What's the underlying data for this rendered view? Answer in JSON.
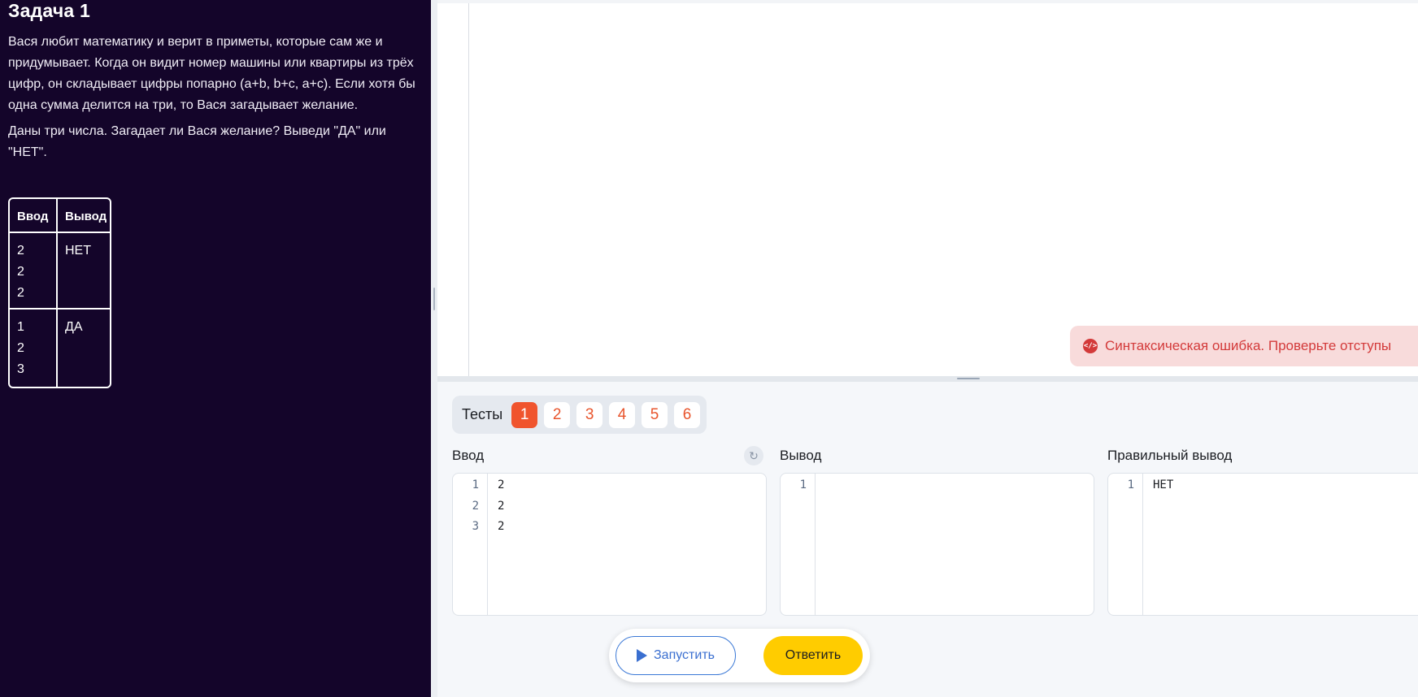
{
  "task": {
    "title": "Задача 1",
    "paragraph1": "Вася любит математику и верит в приметы, которые сам же и придумывает. Когда он видит номер машины или квартиры из трёх цифр, он складывает цифры попарно (a+b, b+c, a+c). Если хотя бы одна сумма делится на три, то Вася загадывает желание.",
    "paragraph2": "Даны три числа. Загадает ли Вася желание? Выведи \"ДА\" или \"НЕТ\".",
    "table": {
      "header_input": "Ввод",
      "header_output": "Вывод",
      "rows": [
        {
          "input": [
            "2",
            "2",
            "2"
          ],
          "output": "НЕТ"
        },
        {
          "input": [
            "1",
            "2",
            "3"
          ],
          "output": "ДА"
        }
      ]
    }
  },
  "editor": {
    "error_icon": "code-icon",
    "error_message": "Синтаксическая ошибка. Проверьте отступы"
  },
  "tests": {
    "label": "Тесты",
    "items": [
      "1",
      "2",
      "3",
      "4",
      "5",
      "6"
    ],
    "active_index": 0
  },
  "io": {
    "input_label": "Ввод",
    "output_label": "Вывод",
    "expected_label": "Правильный вывод",
    "input_lines": [
      "2",
      "2",
      "2"
    ],
    "output_lines": [
      ""
    ],
    "expected_lines": [
      "НЕТ"
    ],
    "refresh_icon": "refresh-icon"
  },
  "actions": {
    "run_label": "Запустить",
    "answer_label": "Ответить"
  },
  "colors": {
    "panel_bg": "#14052a",
    "accent_orange": "#f0542d",
    "answer_yellow": "#ffcc00",
    "run_blue": "#3a6fd0",
    "error_red": "#d33a3a"
  }
}
